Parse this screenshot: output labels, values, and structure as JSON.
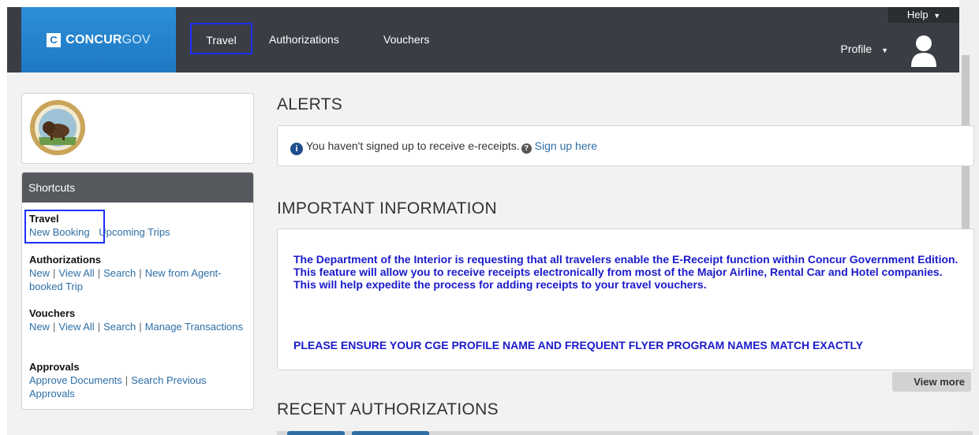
{
  "header": {
    "logo_c": "C",
    "logo_concur": "CONCUR",
    "logo_gov": "GOV",
    "nav": {
      "travel": "Travel",
      "authorizations": "Authorizations",
      "vouchers": "Vouchers"
    },
    "help_label": "Help",
    "profile_label": "Profile"
  },
  "sidebar": {
    "shortcuts_title": "Shortcuts",
    "travel": {
      "title": "Travel",
      "links": [
        "New Booking",
        "Upcoming Trips"
      ]
    },
    "authorizations": {
      "title": "Authorizations",
      "links": [
        "New",
        "View All",
        "Search",
        "New from Agent-booked Trip"
      ]
    },
    "vouchers": {
      "title": "Vouchers",
      "links": [
        "New",
        "View All",
        "Search",
        "Manage Transactions"
      ]
    },
    "approvals": {
      "title": "Approvals",
      "links": [
        "Approve Documents",
        "Search Previous Approvals"
      ]
    }
  },
  "alerts": {
    "title": "ALERTS",
    "message": "You haven't signed up to receive e-receipts.",
    "link": "Sign up here"
  },
  "important": {
    "title": "IMPORTANT INFORMATION",
    "paragraph1": "The Department of the Interior is requesting that all travelers enable the E-Receipt function within Concur Government Edition.  This feature will allow you to receive receipts electronically from most of the Major Airline, Rental Car and Hotel companies.  This will help expedite the process for adding receipts to your travel vouchers.",
    "paragraph2": "PLEASE ENSURE YOUR CGE PROFILE NAME AND FREQUENT FLYER PROGRAM NAMES MATCH EXACTLY",
    "view_more": "View more"
  },
  "recent": {
    "title": "RECENT AUTHORIZATIONS"
  },
  "colors": {
    "header_bg": "#3a3e44",
    "logo_bg": "#1e78c2",
    "highlight": "#1d2fff",
    "link": "#2e6ea6",
    "info_text": "#1a1acc"
  }
}
